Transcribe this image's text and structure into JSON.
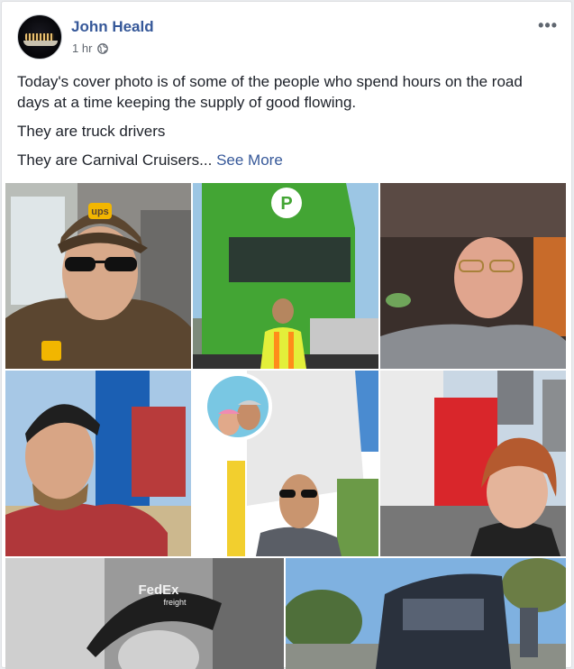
{
  "post": {
    "author": "John Heald",
    "time": "1 hr",
    "privacy_icon": "globe-icon",
    "more_icon": "more-options-icon",
    "more_label": "•••",
    "paragraphs": [
      "Today's cover photo is of some of the people who spend hours on the road days at a time keeping the supply of good flowing.",
      "They are truck drivers",
      "They are Carnival Cruisers..."
    ],
    "separator": " · ",
    "see_more": "See More"
  },
  "photos": [
    {
      "subject": "driver-in-ups-cap",
      "cap_text": "ups"
    },
    {
      "subject": "green-truck-driver",
      "logo_text": "P"
    },
    {
      "subject": "driver-in-cab-with-glasses"
    },
    {
      "subject": "driver-blue-truck"
    },
    {
      "subject": "couple-inset-white-trailer"
    },
    {
      "subject": "woman-red-truck"
    },
    {
      "subject": "fedex-driver-bw",
      "cap_text": "FedEx",
      "cap_sub": "freight"
    },
    {
      "subject": "dark-truck-outdoor"
    }
  ],
  "colors": {
    "link": "#365899",
    "text": "#1d2129",
    "meta": "#616770",
    "ups_brown": "#5b4630",
    "ups_gold": "#f2b600",
    "truck_green": "#43a534",
    "truck_blue": "#1b5fb3",
    "truck_red": "#d9262b"
  }
}
